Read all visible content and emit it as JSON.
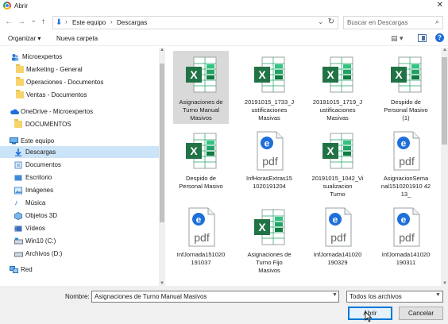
{
  "window": {
    "title": "Abrir",
    "close_glyph": "✕"
  },
  "nav_buttons": {
    "back": "←",
    "forward": "→",
    "history": "⌄",
    "up": "↑"
  },
  "address": {
    "segments": [
      "Este equipo",
      "Descargas"
    ],
    "separator": "›"
  },
  "search": {
    "placeholder": "Buscar en Descargas"
  },
  "toolbar": {
    "organize": "Organizar ▾",
    "new_folder": "Nueva carpeta",
    "view_glyph": "▤ ▾",
    "help": "?"
  },
  "sidebar": {
    "items": [
      {
        "label": "Microexpertos",
        "icon": "people-icon"
      },
      {
        "label": "Marketing - General",
        "icon": "folder-icon"
      },
      {
        "label": "Operaciones - Documentos",
        "icon": "folder-icon"
      },
      {
        "label": "Ventas - Documentos",
        "icon": "folder-icon"
      },
      {
        "label": "OneDrive - Microexpertos",
        "icon": "cloud-icon"
      },
      {
        "label": "DOCUMENTOS",
        "icon": "folder-icon"
      },
      {
        "label": "Este equipo",
        "icon": "computer-icon"
      },
      {
        "label": "Descargas",
        "icon": "download-icon"
      },
      {
        "label": "Documentos",
        "icon": "documents-icon"
      },
      {
        "label": "Escritorio",
        "icon": "desktop-icon"
      },
      {
        "label": "Imágenes",
        "icon": "pictures-icon"
      },
      {
        "label": "Música",
        "icon": "music-icon"
      },
      {
        "label": "Objetos 3D",
        "icon": "objects3d-icon"
      },
      {
        "label": "Vídeos",
        "icon": "videos-icon"
      },
      {
        "label": "Win10 (C:)",
        "icon": "drive-icon"
      },
      {
        "label": "Archivos (D:)",
        "icon": "drive-icon"
      },
      {
        "label": "Red",
        "icon": "network-icon"
      }
    ]
  },
  "files": [
    {
      "name": "Asignaciones de\nTurno Manual\nMasivos",
      "type": "excel"
    },
    {
      "name": "20191015_1733_J\nustificaciones\nMasivas",
      "type": "excel"
    },
    {
      "name": "20191015_1719_J\nustificaciones\nMasivas",
      "type": "excel"
    },
    {
      "name": "Despido de\nPersonal Masivo\n(1)",
      "type": "excel"
    },
    {
      "name": "Despido de\nPersonal Masivo",
      "type": "excel"
    },
    {
      "name": "InfHorasExtras15\n1020191204",
      "type": "pdf"
    },
    {
      "name": "20191015_1042_Vi\nsualizacion\nTurno",
      "type": "excel"
    },
    {
      "name": "AsignacionSema\nnal1510201910 42\n13_",
      "type": "pdf"
    },
    {
      "name": "InfJornada151020\n191037",
      "type": "pdf"
    },
    {
      "name": "Asignaciones de\nTurno Fijo\nMasivos",
      "type": "excel"
    },
    {
      "name": "InfJornada141020\n190329",
      "type": "pdf"
    },
    {
      "name": "InfJornada141020\n190311",
      "type": "pdf"
    }
  ],
  "bottom": {
    "name_label": "Nombre:",
    "name_value": "Asignaciones de Turno Manual Masivos",
    "filter_value": "Todos los archivos",
    "open_label": "Abrir",
    "cancel_label": "Cancelar"
  },
  "colors": {
    "excel": "#217346",
    "pdf_blue": "#1e6fd9",
    "selected_nav": "#cce4f7",
    "selected_file": "#d9d9d9"
  }
}
